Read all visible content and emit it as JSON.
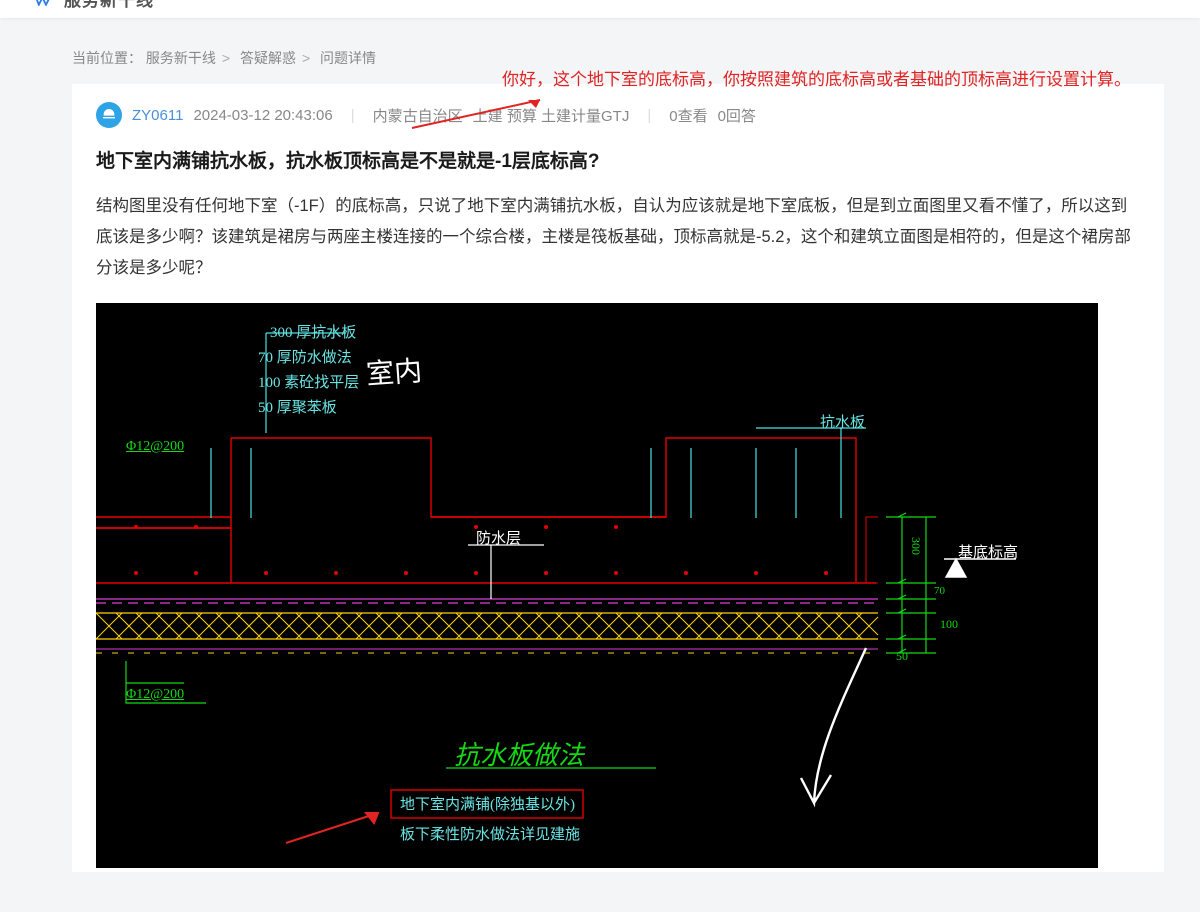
{
  "logo_text": "服务新干线",
  "breadcrumb": {
    "label": "当前位置：",
    "a": "服务新干线",
    "b": "答疑解惑",
    "c": "问题详情"
  },
  "annotation": "你好，这个地下室的底标高，你按照建筑的底标高或者基础的顶标高进行设置计算。",
  "meta": {
    "user": "ZY0611",
    "time": "2024-03-12 20:43:06",
    "region": "内蒙古自治区",
    "cat": "土建 预算 土建计量GTJ",
    "views": "0查看",
    "answers": "0回答"
  },
  "title": "地下室内满铺抗水板，抗水板顶标高是不是就是-1层底标高?",
  "body": "结构图里没有任何地下室（-1F）的底标高，只说了地下室内满铺抗水板，自认为应该就是地下室底板，但是到立面图里又看不懂了，所以这到底该是多少啊？该建筑是裙房与两座主楼连接的一个综合楼，主楼是筏板基础，顶标高就是-5.2，这个和建筑立面图是相符的，但是这个裙房部分该是多少呢？",
  "cad": {
    "layers": {
      "l1": "300 厚抗水板",
      "l2": "70 厚防水做法",
      "l3": "100 素砼找平层",
      "l4": "50 厚聚苯板"
    },
    "hand1": "室内",
    "rebar1": "Φ12@200",
    "rebar2": "Φ12@200",
    "lbl_wp": "防水层",
    "lbl_slab": "抗水板",
    "lbl_base": "基底标高",
    "d300": "300",
    "d70": "70",
    "d100": "100",
    "d50": "50",
    "title2": "抗水板做法",
    "note1": "地下室内满铺(除独基以外)",
    "note2": "板下柔性防水做法详见建施"
  }
}
